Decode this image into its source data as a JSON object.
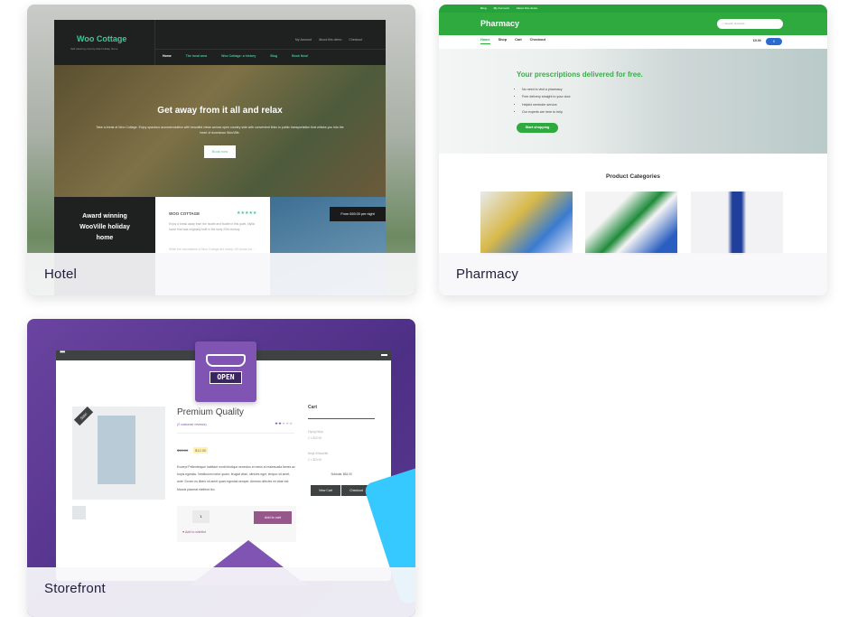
{
  "cards": [
    {
      "label": "Hotel",
      "preview": {
        "site_title": "Woo Cottage",
        "tagline": "Self catering country side holiday home",
        "top_links": [
          "My Account",
          "About this demo",
          "Checkout"
        ],
        "nav": [
          "Home",
          "The local area",
          "Woo Cottage: a history",
          "Blog",
          "Book Now!"
        ],
        "hero_title": "Get away from it all and relax",
        "hero_text": "Take a break at Woo Cottage. Enjoy spacious accommodation with beautiful views across open country side with convenient links to public transportation that whisks you into the heart of downtown WooVille.",
        "hero_button": "Book now",
        "award_text": "Award winning WooVille holiday home",
        "box_title": "WOO COTTAGE",
        "box_stars": 5,
        "box_text": "Enjoy a break away from the hustle and bustle in this quiet, idyllic home that was originally built in the early 20th century.",
        "box_text2": "While the foundations of Woo Cottage are nearly 100 years old...",
        "price_tag": "From £69.00 per night"
      }
    },
    {
      "label": "Pharmacy",
      "preview": {
        "top_links": [
          "Blog",
          "My Account",
          "About this demo"
        ],
        "site_title": "Pharmacy",
        "search_placeholder": "Search products...",
        "nav": [
          "Home",
          "Shop",
          "Cart",
          "Checkout"
        ],
        "cart_total": "£0.00",
        "cart_count": "0",
        "hero_title": "Your prescriptions delivered for free.",
        "bullets": [
          "No need to visit a pharmacy",
          "Free delivery straight to your door",
          "Helpful reminder service",
          "Our experts are here to help"
        ],
        "hero_button": "Start shopping",
        "section_title": "Product Categories",
        "accent": "#2eaa3f"
      }
    },
    {
      "label": "Storefront",
      "preview": {
        "badge_text": "OPEN",
        "sale_ribbon": "Sale!",
        "product_title": "Premium Quality",
        "reviews": "(2 customer reviews)",
        "rating": 2,
        "old_price": "$15.00",
        "price": "$12.00",
        "description": "Excerpt Pellentesque habitant morbi tristique senectus et netus et malesuada fames ac turpis egestas. Vestibulum tortor quam, feugiat vitae, ultricies eget, tempor sit amet, ante. Donec eu libero sit amet quam egestas semper. Aenean ultricies mi vitae est. Mauris placerat eleifend leo.",
        "quantity": "1",
        "add_to_cart": "Add to cart",
        "wishlist": "Add to wishlist",
        "cart_title": "Cart",
        "cart_items": [
          {
            "name": "Flying Ninja",
            "qty": "2 × $12.00"
          },
          {
            "name": "Ninja Silhouette",
            "qty": "2 × $20.00"
          }
        ],
        "subtotal": "Subtotal: $64.00",
        "view_cart": "View Cart",
        "checkout": "Checkout",
        "accent": "#7f54b3"
      }
    }
  ]
}
